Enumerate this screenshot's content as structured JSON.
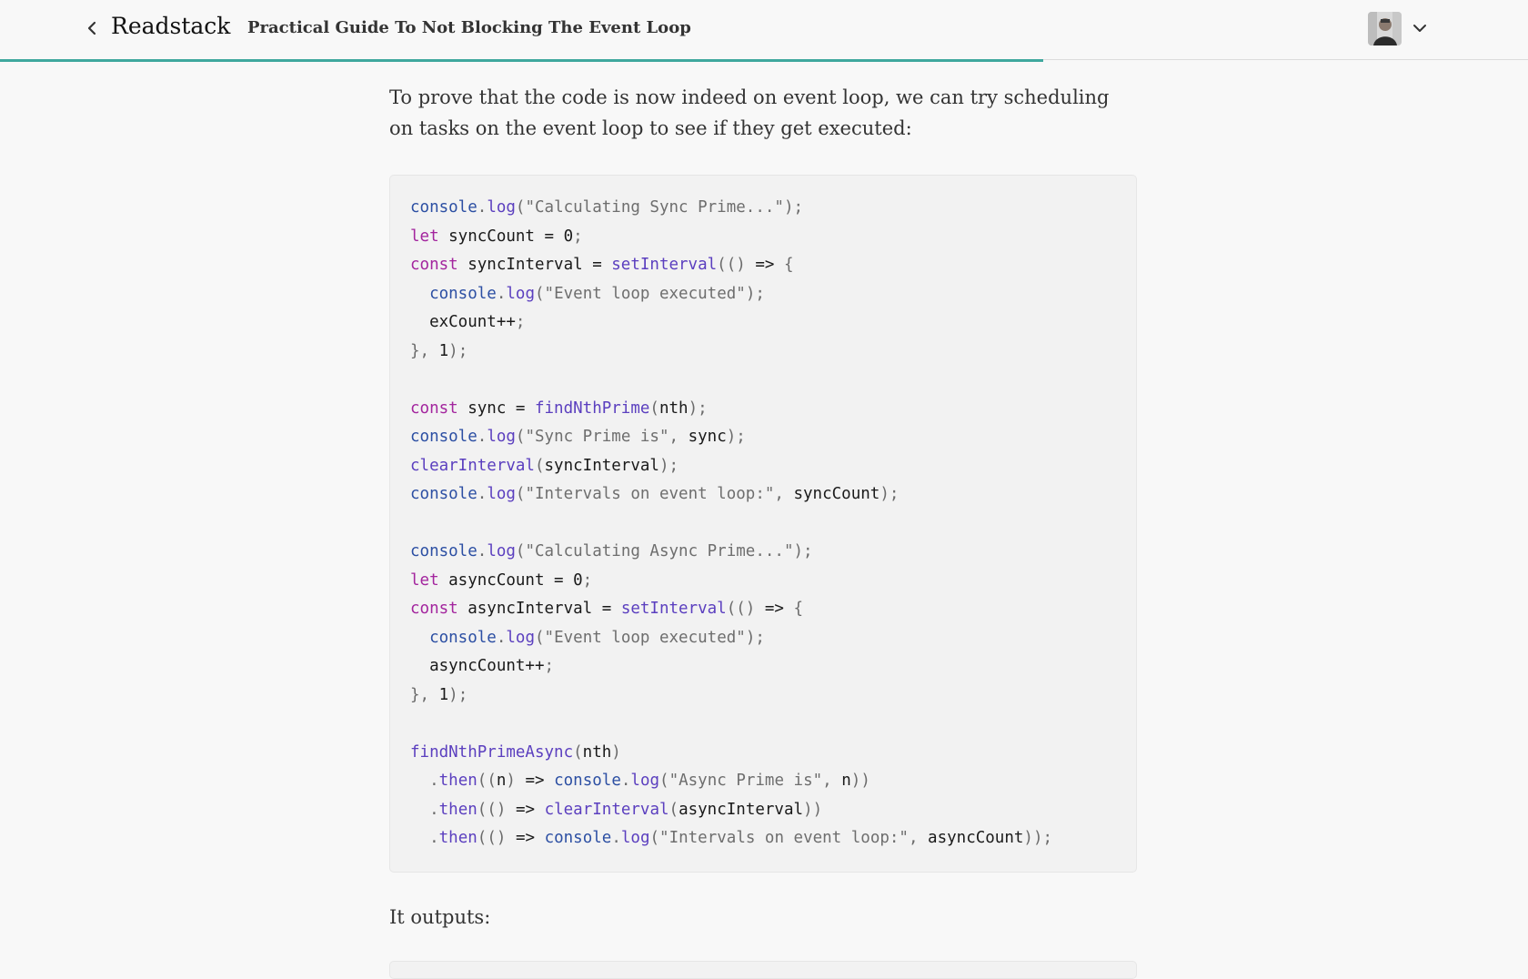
{
  "header": {
    "brand": "Readstack",
    "article_title": "Practical Guide To Not Blocking The Event Loop",
    "back_icon": "chevron-left-icon",
    "menu_icon": "chevron-down-icon",
    "reading_progress_percent": 68.3,
    "accent_color": "#3fa89e"
  },
  "article": {
    "intro": "To prove that the code is now indeed on event loop, we can try scheduling on tasks on the event loop to see if they get executed:",
    "outro": "It outputs:",
    "code_lines": [
      [
        [
          "obj",
          "console"
        ],
        [
          "punc",
          "."
        ],
        [
          "fn",
          "log"
        ],
        [
          "punc",
          "("
        ],
        [
          "str",
          "\"Calculating Sync Prime...\""
        ],
        [
          "punc",
          ");"
        ]
      ],
      [
        [
          "kw",
          "let"
        ],
        [
          "id",
          " syncCount = "
        ],
        [
          "num",
          "0"
        ],
        [
          "punc",
          ";"
        ]
      ],
      [
        [
          "kw",
          "const"
        ],
        [
          "id",
          " syncInterval = "
        ],
        [
          "fn",
          "setInterval"
        ],
        [
          "punc",
          "(() "
        ],
        [
          "id",
          "=>"
        ],
        [
          "punc",
          " {"
        ]
      ],
      [
        [
          "id",
          "  "
        ],
        [
          "obj",
          "console"
        ],
        [
          "punc",
          "."
        ],
        [
          "fn",
          "log"
        ],
        [
          "punc",
          "("
        ],
        [
          "str",
          "\"Event loop executed\""
        ],
        [
          "punc",
          ");"
        ]
      ],
      [
        [
          "id",
          "  exCount++"
        ],
        [
          "punc",
          ";"
        ]
      ],
      [
        [
          "punc",
          "}, "
        ],
        [
          "num",
          "1"
        ],
        [
          "punc",
          ");"
        ]
      ],
      [],
      [
        [
          "kw",
          "const"
        ],
        [
          "id",
          " sync = "
        ],
        [
          "fn",
          "findNthPrime"
        ],
        [
          "punc",
          "("
        ],
        [
          "id",
          "nth"
        ],
        [
          "punc",
          ");"
        ]
      ],
      [
        [
          "obj",
          "console"
        ],
        [
          "punc",
          "."
        ],
        [
          "fn",
          "log"
        ],
        [
          "punc",
          "("
        ],
        [
          "str",
          "\"Sync Prime is\""
        ],
        [
          "punc",
          ", "
        ],
        [
          "id",
          "sync"
        ],
        [
          "punc",
          ");"
        ]
      ],
      [
        [
          "fn",
          "clearInterval"
        ],
        [
          "punc",
          "("
        ],
        [
          "id",
          "syncInterval"
        ],
        [
          "punc",
          ");"
        ]
      ],
      [
        [
          "obj",
          "console"
        ],
        [
          "punc",
          "."
        ],
        [
          "fn",
          "log"
        ],
        [
          "punc",
          "("
        ],
        [
          "str",
          "\"Intervals on event loop:\""
        ],
        [
          "punc",
          ", "
        ],
        [
          "id",
          "syncCount"
        ],
        [
          "punc",
          ");"
        ]
      ],
      [],
      [
        [
          "obj",
          "console"
        ],
        [
          "punc",
          "."
        ],
        [
          "fn",
          "log"
        ],
        [
          "punc",
          "("
        ],
        [
          "str",
          "\"Calculating Async Prime...\""
        ],
        [
          "punc",
          ");"
        ]
      ],
      [
        [
          "kw",
          "let"
        ],
        [
          "id",
          " asyncCount = "
        ],
        [
          "num",
          "0"
        ],
        [
          "punc",
          ";"
        ]
      ],
      [
        [
          "kw",
          "const"
        ],
        [
          "id",
          " asyncInterval = "
        ],
        [
          "fn",
          "setInterval"
        ],
        [
          "punc",
          "(() "
        ],
        [
          "id",
          "=>"
        ],
        [
          "punc",
          " {"
        ]
      ],
      [
        [
          "id",
          "  "
        ],
        [
          "obj",
          "console"
        ],
        [
          "punc",
          "."
        ],
        [
          "fn",
          "log"
        ],
        [
          "punc",
          "("
        ],
        [
          "str",
          "\"Event loop executed\""
        ],
        [
          "punc",
          ");"
        ]
      ],
      [
        [
          "id",
          "  asyncCount++"
        ],
        [
          "punc",
          ";"
        ]
      ],
      [
        [
          "punc",
          "}, "
        ],
        [
          "num",
          "1"
        ],
        [
          "punc",
          ");"
        ]
      ],
      [],
      [
        [
          "fn",
          "findNthPrimeAsync"
        ],
        [
          "punc",
          "("
        ],
        [
          "id",
          "nth"
        ],
        [
          "punc",
          ")"
        ]
      ],
      [
        [
          "id",
          "  "
        ],
        [
          "punc",
          "."
        ],
        [
          "fn",
          "then"
        ],
        [
          "punc",
          "(("
        ],
        [
          "id",
          "n"
        ],
        [
          "punc",
          ") "
        ],
        [
          "id",
          "=>"
        ],
        [
          "id",
          " "
        ],
        [
          "obj",
          "console"
        ],
        [
          "punc",
          "."
        ],
        [
          "fn",
          "log"
        ],
        [
          "punc",
          "("
        ],
        [
          "str",
          "\"Async Prime is\""
        ],
        [
          "punc",
          ", "
        ],
        [
          "id",
          "n"
        ],
        [
          "punc",
          "))"
        ]
      ],
      [
        [
          "id",
          "  "
        ],
        [
          "punc",
          "."
        ],
        [
          "fn",
          "then"
        ],
        [
          "punc",
          "(() "
        ],
        [
          "id",
          "=>"
        ],
        [
          "id",
          " "
        ],
        [
          "fn",
          "clearInterval"
        ],
        [
          "punc",
          "("
        ],
        [
          "id",
          "asyncInterval"
        ],
        [
          "punc",
          "))"
        ]
      ],
      [
        [
          "id",
          "  "
        ],
        [
          "punc",
          "."
        ],
        [
          "fn",
          "then"
        ],
        [
          "punc",
          "(() "
        ],
        [
          "id",
          "=>"
        ],
        [
          "id",
          " "
        ],
        [
          "obj",
          "console"
        ],
        [
          "punc",
          "."
        ],
        [
          "fn",
          "log"
        ],
        [
          "punc",
          "("
        ],
        [
          "str",
          "\"Intervals on event loop:\""
        ],
        [
          "punc",
          ", "
        ],
        [
          "id",
          "asyncCount"
        ],
        [
          "punc",
          "));"
        ]
      ]
    ]
  }
}
